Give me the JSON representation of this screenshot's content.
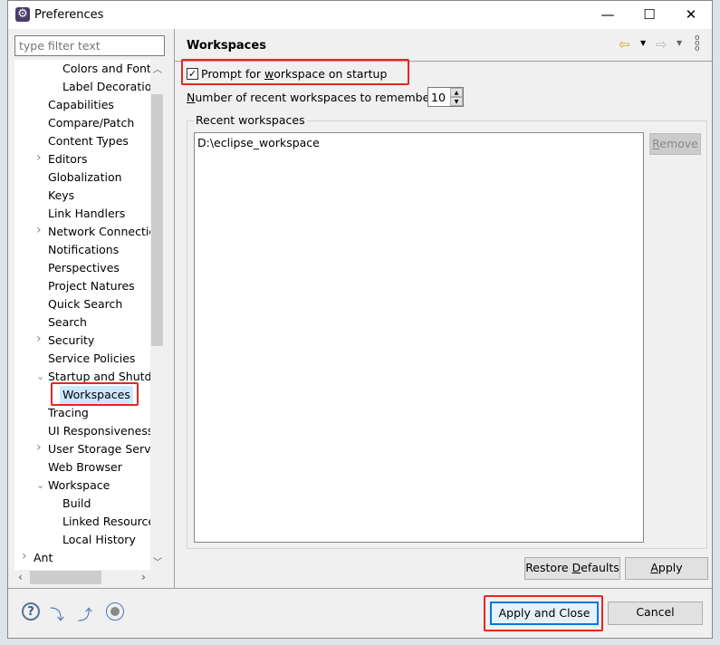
{
  "window": {
    "title": "Preferences",
    "minimize": "—",
    "maximize": "☐",
    "close": "✕"
  },
  "filter": {
    "placeholder": "type filter text"
  },
  "tree": [
    {
      "label": "Colors and Fonts",
      "level": 2
    },
    {
      "label": "Label Decorations",
      "level": 2
    },
    {
      "label": "Capabilities",
      "level": 1
    },
    {
      "label": "Compare/Patch",
      "level": 1
    },
    {
      "label": "Content Types",
      "level": 1
    },
    {
      "label": "Editors",
      "level": 1,
      "expander": "collapsed"
    },
    {
      "label": "Globalization",
      "level": 1
    },
    {
      "label": "Keys",
      "level": 1
    },
    {
      "label": "Link Handlers",
      "level": 1
    },
    {
      "label": "Network Connections",
      "level": 1,
      "expander": "collapsed"
    },
    {
      "label": "Notifications",
      "level": 1
    },
    {
      "label": "Perspectives",
      "level": 1
    },
    {
      "label": "Project Natures",
      "level": 1
    },
    {
      "label": "Quick Search",
      "level": 1
    },
    {
      "label": "Search",
      "level": 1
    },
    {
      "label": "Security",
      "level": 1,
      "expander": "collapsed"
    },
    {
      "label": "Service Policies",
      "level": 1
    },
    {
      "label": "Startup and Shutdown",
      "level": 1,
      "expander": "expanded"
    },
    {
      "label": "Workspaces",
      "level": 2,
      "selected": true
    },
    {
      "label": "Tracing",
      "level": 1
    },
    {
      "label": "UI Responsiveness",
      "level": 1
    },
    {
      "label": "User Storage Service",
      "level": 1,
      "expander": "collapsed"
    },
    {
      "label": "Web Browser",
      "level": 1
    },
    {
      "label": "Workspace",
      "level": 1,
      "expander": "expanded"
    },
    {
      "label": "Build",
      "level": 2
    },
    {
      "label": "Linked Resources",
      "level": 2
    },
    {
      "label": "Local History",
      "level": 2
    },
    {
      "label": "Ant",
      "level": 0,
      "expander": "collapsed"
    }
  ],
  "page": {
    "title": "Workspaces",
    "prompt_label_pre": "Prompt for ",
    "prompt_label_u": "w",
    "prompt_label_post": "orkspace on startup",
    "prompt_checked": true,
    "recent_label_u": "N",
    "recent_label_rest": "umber of recent workspaces to remember:",
    "recent_count": "10",
    "group_title": "Recent workspaces",
    "workspaces": [
      "D:\\eclipse_workspace"
    ],
    "remove_u": "R",
    "remove_rest": "emove",
    "restore_pre": "Restore ",
    "restore_u": "D",
    "restore_post": "efaults",
    "apply_u": "A",
    "apply_rest": "pply"
  },
  "footer": {
    "apply_close": "Apply and Close",
    "cancel": "Cancel"
  },
  "highlight_color": "#e8261d"
}
